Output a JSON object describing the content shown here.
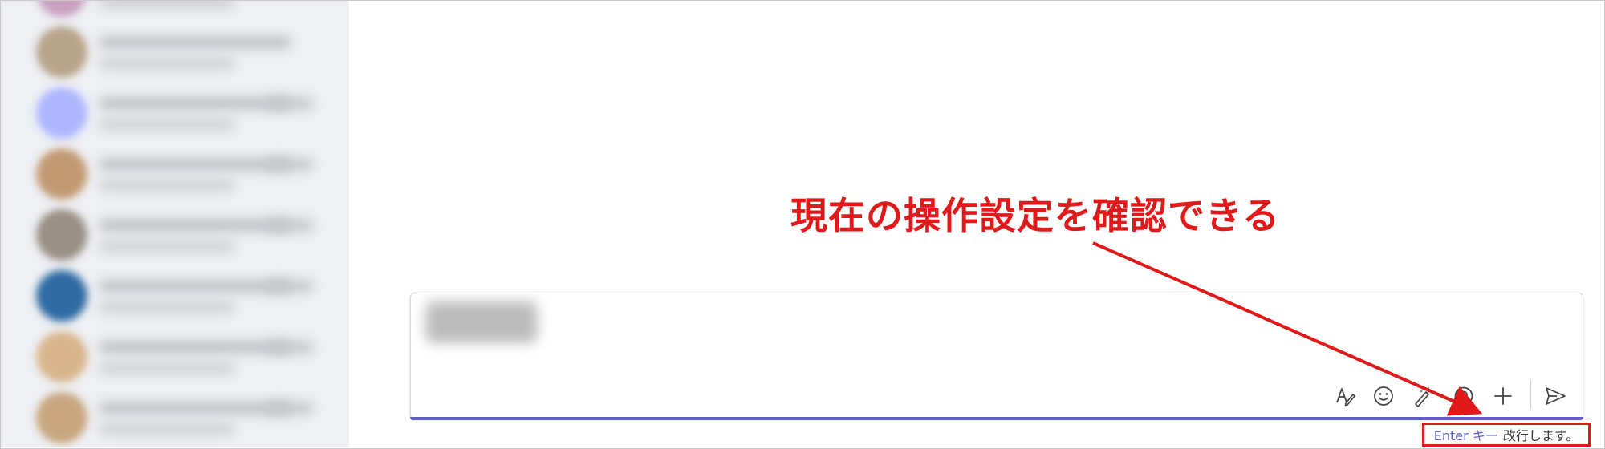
{
  "sidebar": {
    "chat_items": [
      {
        "avatar_color": "#b7a48a"
      },
      {
        "avatar_color": "#aeb6ff"
      },
      {
        "avatar_color": "#c29a72"
      },
      {
        "avatar_color": "#9a8f84"
      },
      {
        "avatar_color": "#2f6aa3"
      },
      {
        "avatar_color": "#d8b58c"
      },
      {
        "avatar_color": "#c8a57e"
      }
    ]
  },
  "compose": {
    "toolbar": {
      "format_icon": "format-icon",
      "emoji_icon": "emoji-icon",
      "ai_rewrite_icon": "magic-pen-icon",
      "loop_icon": "loop-icon",
      "attach_icon": "plus-icon",
      "send_icon": "send-icon"
    }
  },
  "hint": {
    "key": "Enter キー",
    "action": "改行します。"
  },
  "annotation": {
    "text": "現在の操作設定を確認できる"
  },
  "colors": {
    "accent": "#5b5fc7",
    "annotation_red": "#e0191a"
  }
}
